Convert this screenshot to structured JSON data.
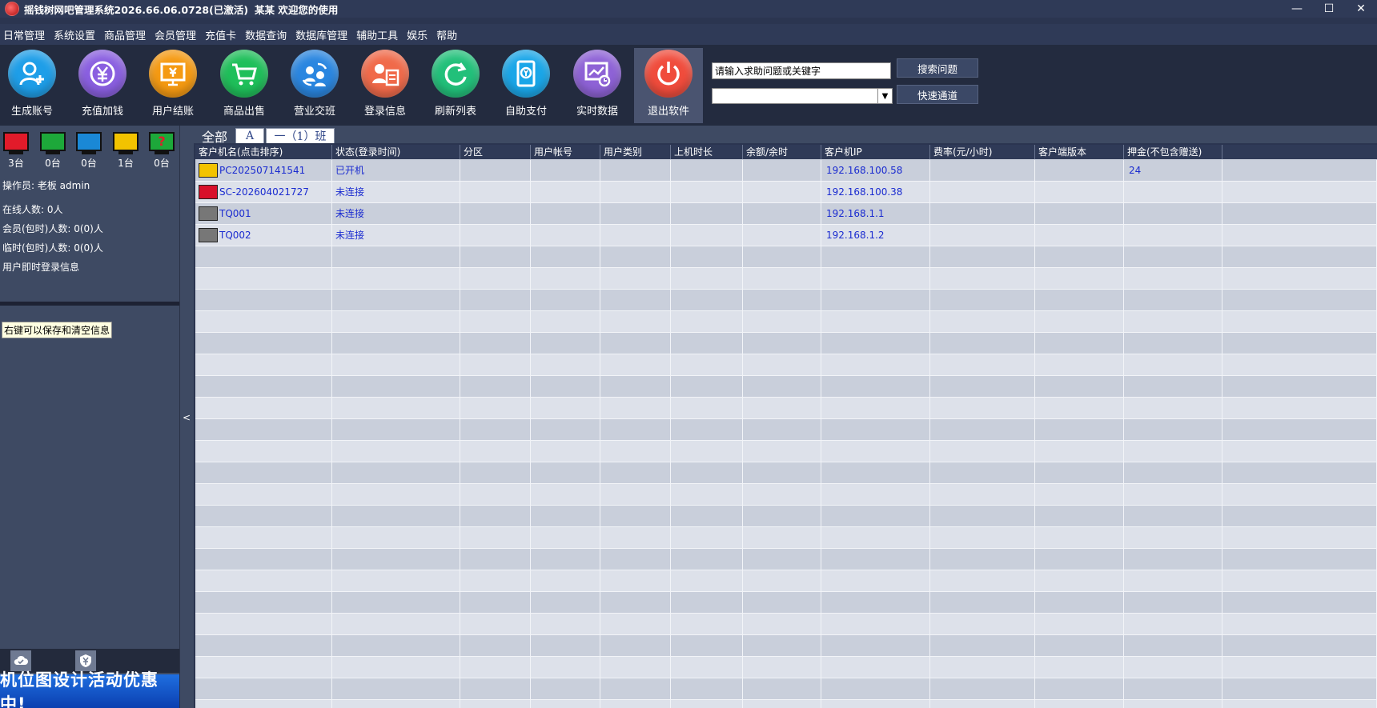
{
  "window": {
    "title": "摇钱树网吧管理系统2026.66.06.0728(已激活)",
    "user_greeting": "某某 欢迎您的使用",
    "controls": [
      "—",
      "☐",
      "✕"
    ]
  },
  "menu": [
    "日常管理",
    "系统设置",
    "商品管理",
    "会员管理",
    "充值卡",
    "数据查询",
    "数据库管理",
    "辅助工具",
    "娱乐",
    "帮助"
  ],
  "toolbar": {
    "tools": [
      {
        "label": "生成账号",
        "icon": "add-user-icon",
        "color": "#1e9ee8"
      },
      {
        "label": "充值加钱",
        "icon": "yen-coin-icon",
        "color": "#8a5fe0"
      },
      {
        "label": "用户结账",
        "icon": "checkout-monitor-icon",
        "color": "#f59a12"
      },
      {
        "label": "商品出售",
        "icon": "shopping-cart-icon",
        "color": "#1fbf5a"
      },
      {
        "label": "营业交班",
        "icon": "shift-handover-icon",
        "color": "#2a86e0"
      },
      {
        "label": "登录信息",
        "icon": "login-info-icon",
        "color": "#f06a4a"
      },
      {
        "label": "刷新列表",
        "icon": "refresh-icon",
        "color": "#22c07a"
      },
      {
        "label": "自助支付",
        "icon": "self-pay-icon",
        "color": "#1aa6e8"
      },
      {
        "label": "实时数据",
        "icon": "realtime-chart-icon",
        "color": "#8e62d6"
      },
      {
        "label": "退出软件",
        "icon": "power-icon",
        "color": "#f04c3c"
      }
    ],
    "search_placeholder": "请输入求助问题或关键字",
    "search_button": "搜索问题",
    "quick_button": "快速通道"
  },
  "status_counts": [
    {
      "color": "#e21b2a",
      "count": "3台",
      "icon": "monitor-red-icon"
    },
    {
      "color": "#1da83a",
      "count": "0台",
      "icon": "monitor-green-icon"
    },
    {
      "color": "#1a88d6",
      "count": "0台",
      "icon": "monitor-blue-icon"
    },
    {
      "color": "#f2c300",
      "count": "1台",
      "icon": "monitor-yellow-icon"
    },
    {
      "color": "#1da83a",
      "count": "0台",
      "icon": "monitor-unknown-icon"
    }
  ],
  "left_info": {
    "operator": "操作员:  老板 admin",
    "online": "在线人数: 0人",
    "member": "会员(包时)人数: 0(0)人",
    "temp": "临时(包时)人数: 0(0)人",
    "login_info": "用户即时登录信息",
    "tooltip": "右键可以保存和清空信息",
    "promo": "机位图设计活动优惠中!"
  },
  "tabs": [
    "全部",
    "A",
    "一（1）班"
  ],
  "table": {
    "headers": [
      "客户机名(点击排序)",
      "状态(登录时间)",
      "分区",
      "用户帐号",
      "用户类别",
      "上机时长",
      "余额/余时",
      "客户机IP",
      "费率(元/小时)",
      "客户端版本",
      "押金(不包含赠送)"
    ],
    "rows": [
      {
        "name": "PC202507141541",
        "status": "已开机",
        "ip": "192.168.100.58",
        "deposit": "24",
        "pc_color": "#f2c300"
      },
      {
        "name": "SC-202604021727",
        "status": "未连接",
        "ip": "192.168.100.38",
        "deposit": "",
        "pc_color": "#d8102a"
      },
      {
        "name": "TQ001",
        "status": "未连接",
        "ip": "192.168.1.1",
        "deposit": "",
        "pc_color": "#777777"
      },
      {
        "name": "TQ002",
        "status": "未连接",
        "ip": "192.168.1.2",
        "deposit": "",
        "pc_color": "#777777"
      }
    ]
  }
}
